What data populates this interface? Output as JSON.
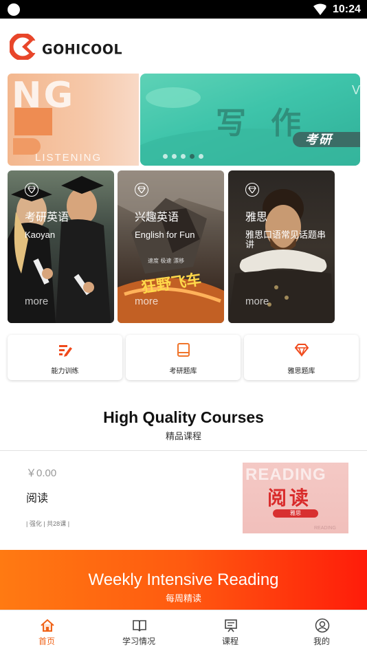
{
  "status_bar": {
    "time": "10:24"
  },
  "header": {
    "logo_text": "GOHICOOL"
  },
  "banner": {
    "prev_slide": {
      "big_text": "NG",
      "sub_text": "LISTENING"
    },
    "current_slide": {
      "title": "写作",
      "pill_text": "考研",
      "edge_text": "V"
    },
    "dots_count": 5,
    "active_dot": 3
  },
  "category_cards": [
    {
      "title": "考研英语",
      "subtitle": "Kaoyan",
      "more": "more"
    },
    {
      "title": "兴趣英语",
      "subtitle": "English for Fun",
      "more": "more"
    },
    {
      "title": "雅思",
      "subtitle": "雅思口语常见话题串讲",
      "more": "more"
    }
  ],
  "quick_actions": [
    {
      "label": "能力训练",
      "icon": "pen-lines-icon"
    },
    {
      "label": "考研题库",
      "icon": "book-icon"
    },
    {
      "label": "雅思题库",
      "icon": "diamond-icon"
    }
  ],
  "section": {
    "title": "High Quality Courses",
    "subtitle": "精品课程"
  },
  "course": {
    "price": "￥0.00",
    "name": "阅读",
    "tags": "| 强化 | 共28课 |",
    "thumb": {
      "reading": "READING",
      "title": "阅读",
      "badge": "雅思",
      "reading_small": "READING"
    }
  },
  "weekly_banner": {
    "title": "Weekly Intensive Reading",
    "subtitle": "每周精读"
  },
  "tab_bar": [
    {
      "label": "首页",
      "icon": "home-icon",
      "active": true
    },
    {
      "label": "学习情况",
      "icon": "open-book-icon",
      "active": false
    },
    {
      "label": "课程",
      "icon": "presentation-board-icon",
      "active": false
    },
    {
      "label": "我的",
      "icon": "user-profile-icon",
      "active": false
    }
  ],
  "colors": {
    "accent": "#f06318",
    "brand_red": "#e8462a",
    "banner_green": "#3ec4aa",
    "weekly_start": "#ff7a12",
    "weekly_end": "#ff1c0a"
  }
}
